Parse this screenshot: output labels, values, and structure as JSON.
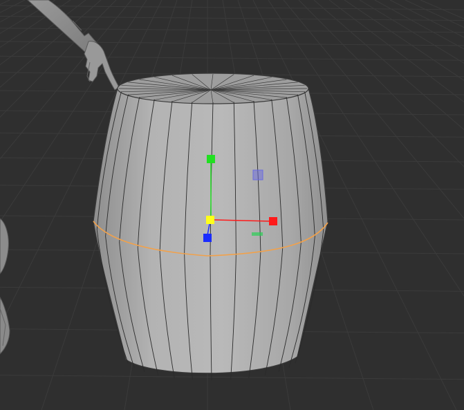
{
  "viewport": {
    "background": "#2f2f2f",
    "grid_color": "#3b3b3b",
    "mesh_fill": "#a9a9a9",
    "mesh_edge": "#2a2a2a",
    "selection_color": "#f2a14a",
    "gizmo": {
      "x_axis_color": "#ff1a1a",
      "y_axis_color": "#21e021",
      "z_axis_color": "#1a2cff",
      "center_color": "#ffff1a",
      "plane_handle_color": "#6a6ae0",
      "scale_handle_color": "#2bcf55"
    }
  }
}
